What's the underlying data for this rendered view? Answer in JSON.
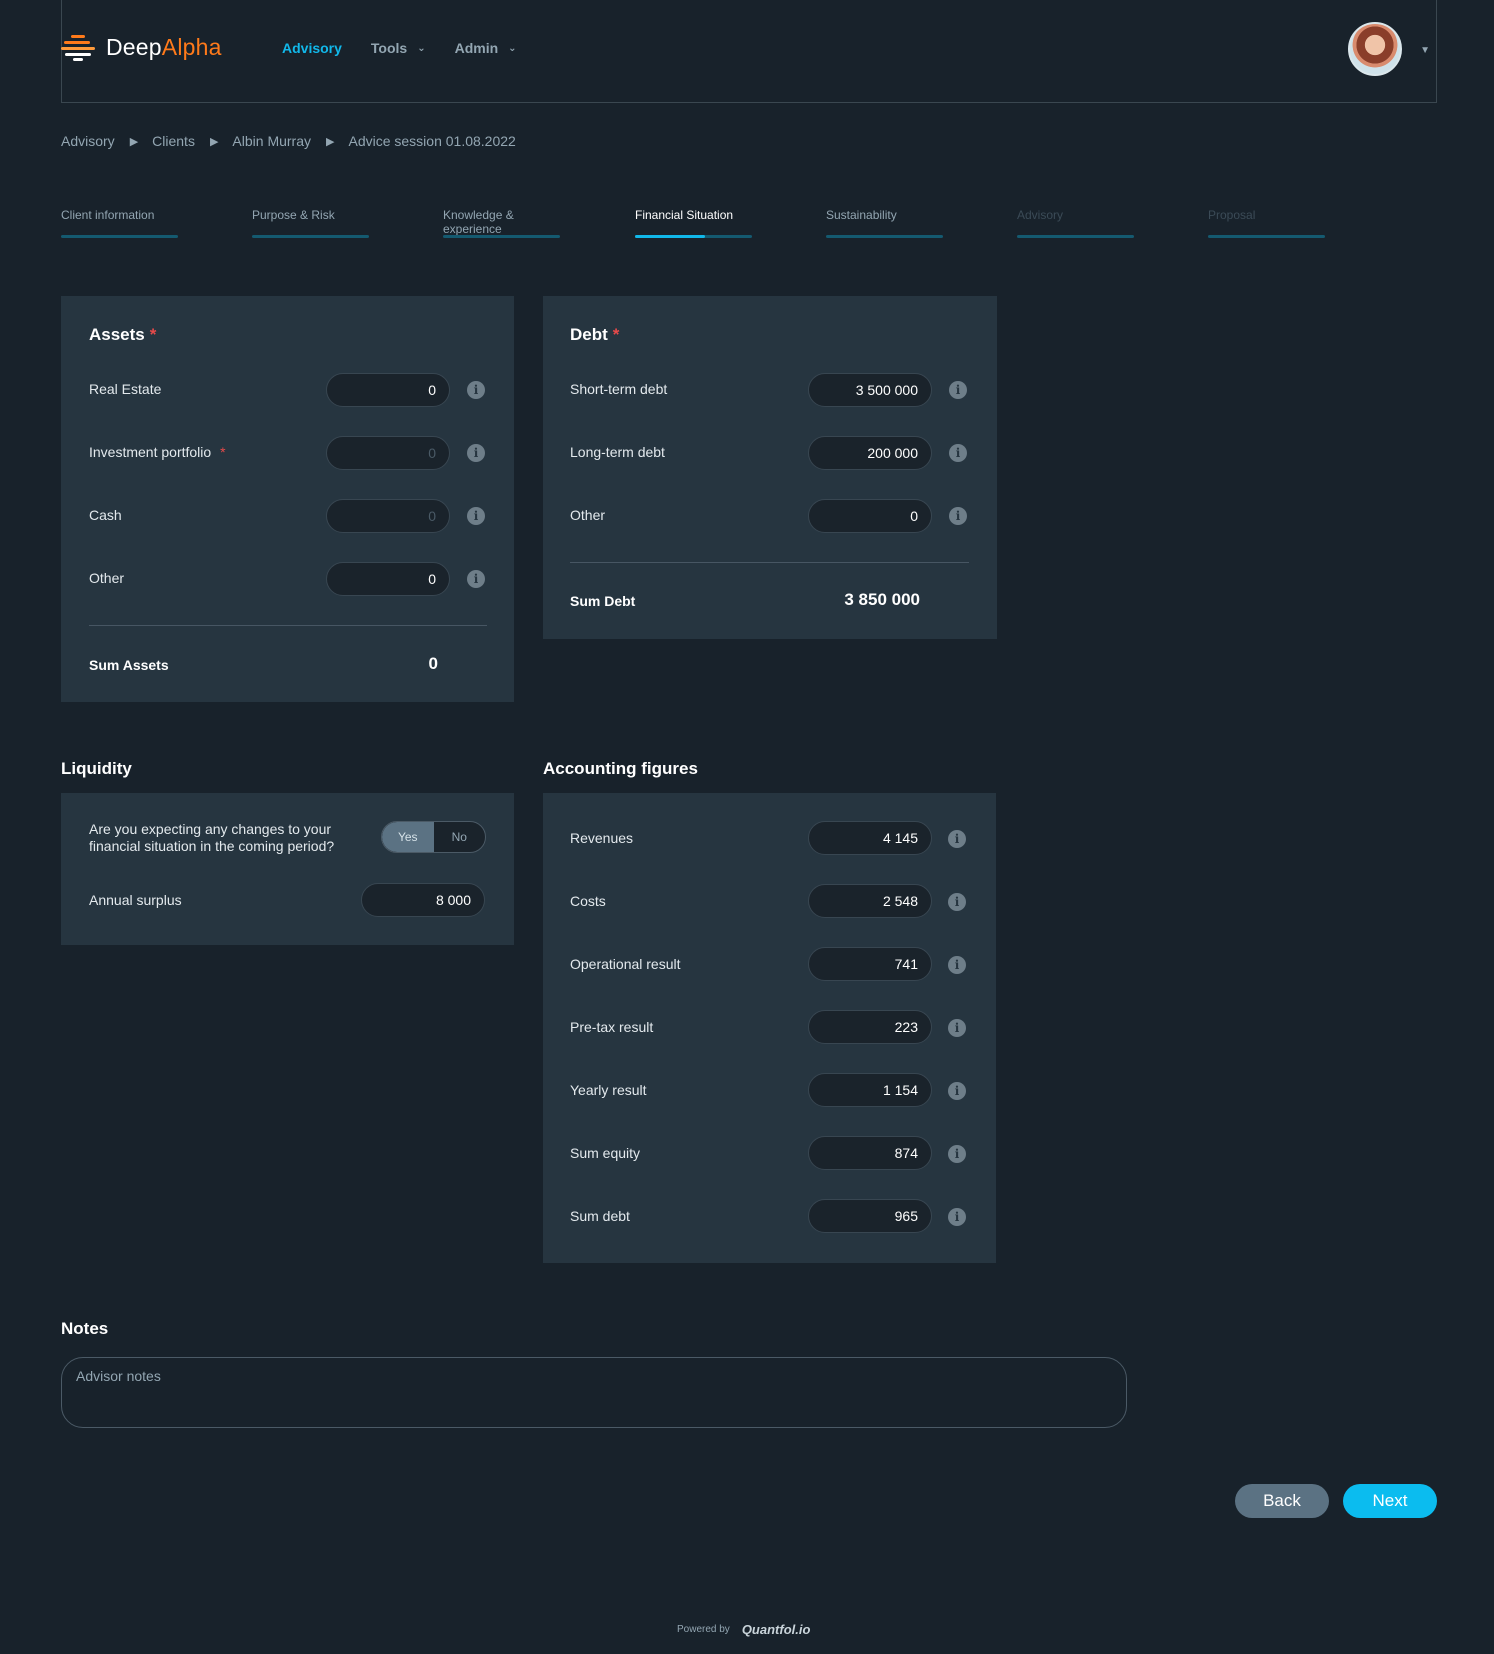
{
  "header": {
    "logo_text_1": "Deep",
    "logo_text_2": "Alpha",
    "nav": [
      {
        "label": "Advisory",
        "active": true
      },
      {
        "label": "Tools",
        "dropdown": true
      },
      {
        "label": "Admin",
        "dropdown": true
      }
    ],
    "avatar_icon": "user-avatar",
    "avatar_menu_icon": "caret-down-icon"
  },
  "breadcrumb": [
    "Advisory",
    "Clients",
    "Albin Murray",
    "Advice session 01.08.2022"
  ],
  "tabs": [
    {
      "label": "Client information",
      "state": "done"
    },
    {
      "label": "Purpose & Risk",
      "state": "done"
    },
    {
      "label": "Knowledge & experience",
      "state": "done"
    },
    {
      "label": "Financial Situation",
      "state": "active",
      "progress": 0.6
    },
    {
      "label": "Sustainability",
      "state": "done"
    },
    {
      "label": "Advisory",
      "state": "disabled"
    },
    {
      "label": "Proposal",
      "state": "disabled"
    }
  ],
  "assets": {
    "title": "Assets",
    "required_mark": "*",
    "rows": [
      {
        "label": "Real Estate",
        "value": "0"
      },
      {
        "label": "Investment portfolio",
        "required": "*",
        "placeholder": "0"
      },
      {
        "label": "Cash",
        "placeholder": "0"
      },
      {
        "label": "Other",
        "value": "0"
      }
    ],
    "sum_label": "Sum Assets",
    "sum_value": "0"
  },
  "debt": {
    "title": "Debt",
    "required_mark": "*",
    "rows": [
      {
        "label": "Short-term debt",
        "value": "3 500 000"
      },
      {
        "label": "Long-term debt",
        "value": "200 000"
      },
      {
        "label": "Other",
        "value": "0"
      }
    ],
    "sum_label": "Sum Debt",
    "sum_value": "3 850 000"
  },
  "liquidity": {
    "title": "Liquidity",
    "question_line1": "Are you expecting any changes to your",
    "question_line2": "financial situation in the coming period?",
    "toggle": {
      "yes": "Yes",
      "no": "No",
      "selected": "Yes"
    },
    "annual_label": "Annual surplus",
    "annual_value": "8 000"
  },
  "accounting": {
    "title": "Accounting figures",
    "rows": [
      {
        "label": "Revenues",
        "value": "4 145"
      },
      {
        "label": "Costs",
        "value": "2 548"
      },
      {
        "label": "Operational result",
        "value": "741"
      },
      {
        "label": "Pre-tax result",
        "value": "223"
      },
      {
        "label": "Yearly result",
        "value": "1 154"
      },
      {
        "label": "Sum equity",
        "value": "874"
      },
      {
        "label": "Sum debt",
        "value": "965"
      }
    ]
  },
  "notes": {
    "title": "Notes",
    "placeholder": "Advisor notes"
  },
  "buttons": {
    "back": "Back",
    "next": "Next"
  },
  "footer": {
    "powered_by": "Powered by",
    "brand": "Quantfol.io"
  },
  "colors": {
    "background": "#18222b",
    "card": "#263540",
    "accent": "#0bbcef",
    "brand_orange": "#ff7a1a",
    "required": "#e84a4a"
  }
}
